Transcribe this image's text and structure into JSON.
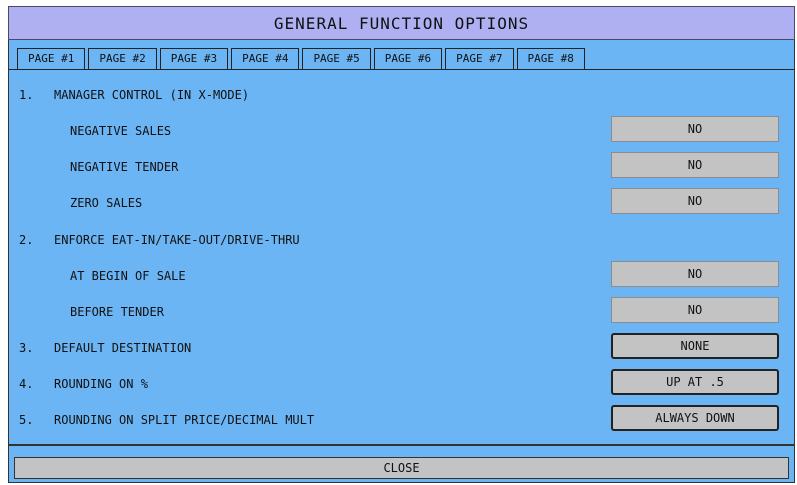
{
  "title": "GENERAL FUNCTION OPTIONS",
  "tabs": [
    "PAGE #1",
    "PAGE #2",
    "PAGE #3",
    "PAGE #4",
    "PAGE #5",
    "PAGE #6",
    "PAGE #7",
    "PAGE #8"
  ],
  "active_tab": "PAGE #1",
  "options": {
    "o1": {
      "number": "1.",
      "label": "MANAGER CONTROL (IN X-MODE)"
    },
    "o1a": {
      "label": "NEGATIVE SALES",
      "value": "NO"
    },
    "o1b": {
      "label": "NEGATIVE TENDER",
      "value": "NO"
    },
    "o1c": {
      "label": "ZERO SALES",
      "value": "NO"
    },
    "o2": {
      "number": "2.",
      "label": "ENFORCE EAT-IN/TAKE-OUT/DRIVE-THRU"
    },
    "o2a": {
      "label": "AT BEGIN OF SALE",
      "value": "NO"
    },
    "o2b": {
      "label": "BEFORE TENDER",
      "value": "NO"
    },
    "o3": {
      "number": "3.",
      "label": "DEFAULT DESTINATION",
      "value": "NONE"
    },
    "o4": {
      "number": "4.",
      "label": "ROUNDING ON %",
      "value": "UP AT .5"
    },
    "o5": {
      "number": "5.",
      "label": "ROUNDING ON SPLIT PRICE/DECIMAL MULT",
      "value": "ALWAYS DOWN"
    }
  },
  "footer": {
    "close_label": "CLOSE"
  },
  "colors": {
    "title_bg": "#aeb0f2",
    "panel_bg": "#6cb5f5",
    "button_bg": "#c3c3c3"
  }
}
